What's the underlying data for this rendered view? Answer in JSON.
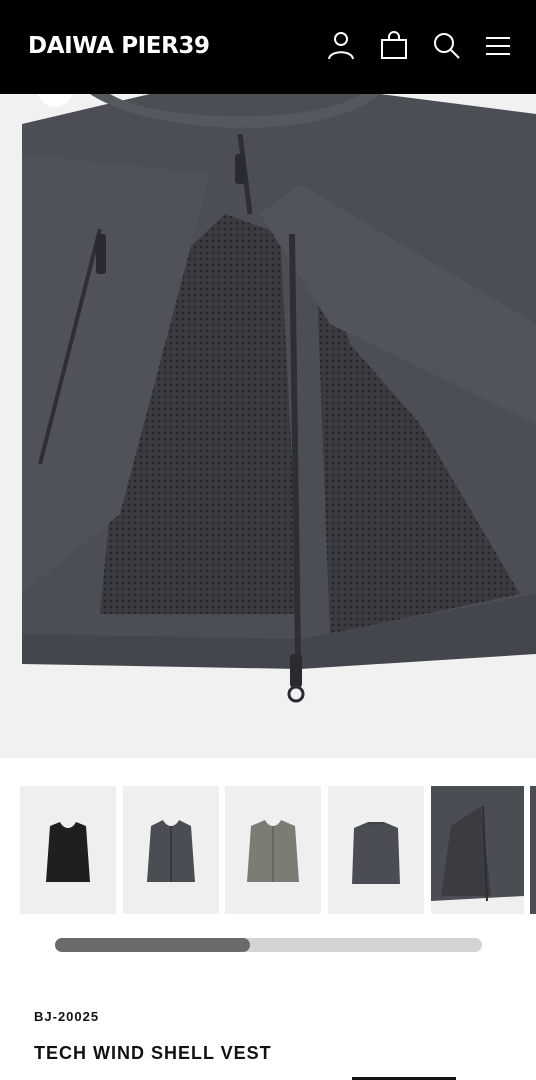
{
  "header": {
    "brand": "DAIWA PIER39",
    "icons": [
      "account-icon",
      "bag-icon",
      "search-icon",
      "menu-icon"
    ]
  },
  "gallery": {
    "thumbnails": [
      {
        "label": "black vest front",
        "color": "#1f1f1f"
      },
      {
        "label": "charcoal vest front",
        "color": "#4b4d55"
      },
      {
        "label": "olive gray vest front",
        "color": "#7a7d73"
      },
      {
        "label": "charcoal vest back",
        "color": "#4b4d55"
      },
      {
        "label": "charcoal vest detail",
        "color": "#4b4d55"
      }
    ],
    "active_index": 4,
    "scroll_position": 0.46
  },
  "product": {
    "sku": "BJ-20025",
    "title": "TECH WIND SHELL VEST"
  },
  "colors": {
    "header_bg": "#000000",
    "fabric": "#4b4d55",
    "mesh": "#383a3f",
    "scroll_thumb": "#6b6b6b",
    "scroll_track": "#d4d4d4"
  }
}
